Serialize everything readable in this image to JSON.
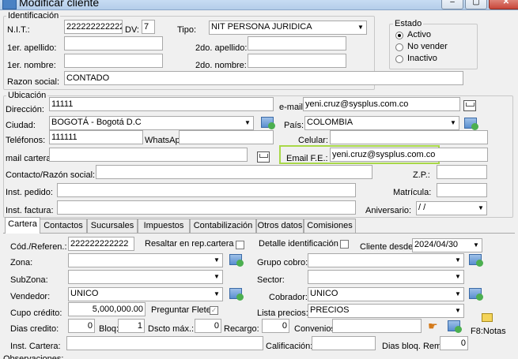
{
  "window": {
    "title": "Modificar cliente",
    "min": "–",
    "max": "▢",
    "close": "✕"
  },
  "identificacion": {
    "legend": "Identificación",
    "nit_label": "N.I.T.:",
    "nit": "222222222222",
    "dv_label": "DV:",
    "dv": "7",
    "tipo_label": "Tipo:",
    "tipo": "NIT PERSONA JURIDICA",
    "ape1_label": "1er. apellido:",
    "ape2_label": "2do. apellido:",
    "nom1_label": "1er. nombre:",
    "nom2_label": "2do. nombre:",
    "razon_label": "Razon social:",
    "razon": "CONTADO"
  },
  "estado": {
    "legend": "Estado",
    "options": [
      "Activo",
      "No vender",
      "Inactivo"
    ],
    "selected": "Activo"
  },
  "ubicacion": {
    "legend": "Ubicación",
    "direccion_label": "Dirección:",
    "direccion": "11111",
    "email_label": "e-mail:",
    "email": "yeni.cruz@sysplus.com.co",
    "ciudad_label": "Ciudad:",
    "ciudad": "BOGOTÁ - Bogotá D.C",
    "pais_label": "País:",
    "pais": "COLOMBIA",
    "telefonos_label": "Teléfonos:",
    "telefonos": "111111",
    "whatsapp_label": "WhatsAp",
    "celular_label": "Celular:",
    "mailcartera_label": "mail cartera:",
    "emailfe_label": "Email F.E.:",
    "emailfe": "yeni.cruz@sysplus.com.co",
    "contacto_label": "Contacto/Razón social:",
    "zp_label": "Z.P.:",
    "instpedido_label": "Inst. pedido:",
    "matricula_label": "Matrícula:",
    "instfactura_label": "Inst. factura:",
    "aniversario_label": "Aniversario:",
    "aniversario": " /  /"
  },
  "tabs": [
    "Cartera",
    "Contactos",
    "Sucursales",
    "Impuestos",
    "Contabilización",
    "Otros datos",
    "Comisiones"
  ],
  "cartera": {
    "codref_label": "Cód./Referen.:",
    "codref": "222222222222",
    "resaltar_label": "Resaltar en rep.cartera",
    "detalle_label": "Detalle identificación",
    "clientedesde_label": "Cliente desde:",
    "clientedesde": "2024/04/30",
    "zona_label": "Zona:",
    "grupocobro_label": "Grupo cobro:",
    "subzona_label": "SubZona:",
    "sector_label": "Sector:",
    "vendedor_label": "Vendedor:",
    "vendedor": "UNICO",
    "cobrador_label": "Cobrador:",
    "cobrador": "UNICO",
    "cupo_label": "Cupo crédito:",
    "cupo": "5,000,000.00",
    "preguntar_label": "Preguntar Flete",
    "listaprecios_label": "Lista precios:",
    "listaprecios": "PRECIOS",
    "diascredito_label": "Dias credito:",
    "diascredito": "0",
    "bloq_label": "Bloq:",
    "bloq": "1",
    "dscto_label": "Dscto máx.:",
    "dscto": "0",
    "recargo_label": "Recargo:",
    "recargo": "0",
    "convenios_label": "Convenios:",
    "notas_label": "F8:Notas",
    "instcartera_label": "Inst. Cartera:",
    "calificacion_label": "Calificación:",
    "diasbloq_label": "Dias bloq. Rem:",
    "diasbloq": "0",
    "observaciones_label": "Observaciones:"
  }
}
